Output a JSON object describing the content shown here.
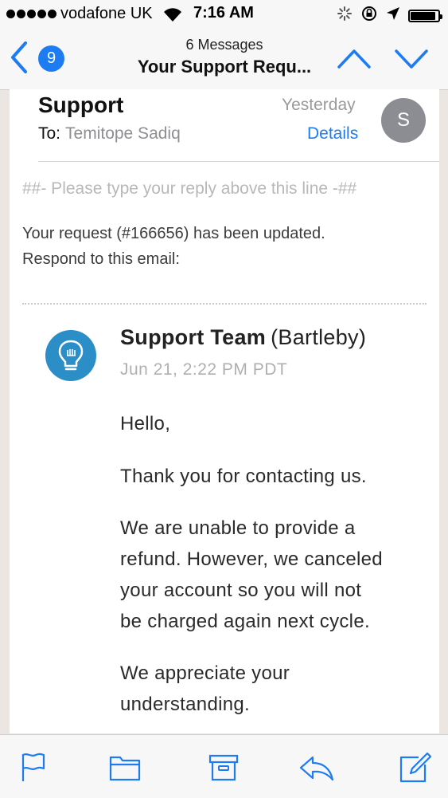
{
  "status_bar": {
    "carrier": "vodafone UK",
    "time": "7:16 AM",
    "battery_level": 0.92
  },
  "nav": {
    "back_count": "9",
    "message_count": "6 Messages",
    "subject": "Your Support Requ..."
  },
  "message": {
    "sender": "Support",
    "to_label": "To:",
    "to_name": "Temitope Sadiq",
    "date": "Yesterday",
    "details_label": "Details",
    "avatar_initial": "S"
  },
  "content": {
    "reply_line": "##- Please type your reply above this line -##",
    "update_line1": "Your request (#166656) has been updated.",
    "update_line2": "Respond to this email:",
    "team_name": "Support Team",
    "team_org": "(Bartleby)",
    "msg_date": "Jun 21, 2:22 PM PDT",
    "greeting": "Hello,",
    "thanks": "Thank you for contacting us.",
    "refund_line1": "We are unable to provide a",
    "refund_line2": "refund. However, we canceled",
    "refund_line3": "your account so you will not",
    "refund_line4": "be charged again next cycle.",
    "appreciate_line1": "We appreciate your",
    "appreciate_line2": "understanding."
  },
  "toolbar": {
    "icons": [
      "flag-icon",
      "folder-icon",
      "archive-icon",
      "reply-icon",
      "compose-icon"
    ]
  },
  "colors": {
    "accent": "#1e7cf2",
    "logo": "#2b8ec7",
    "avatar": "#8c8d93"
  }
}
